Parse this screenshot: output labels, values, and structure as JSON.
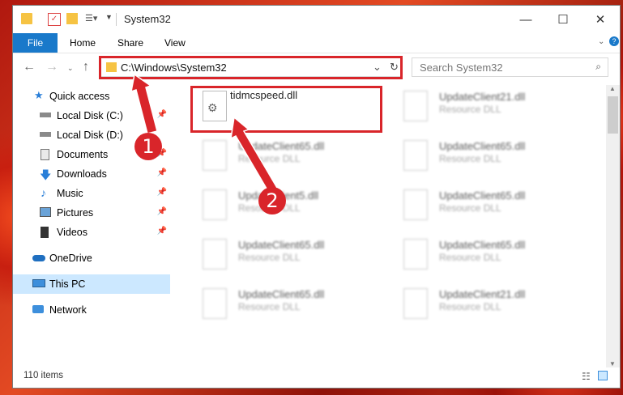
{
  "window": {
    "title": "System32"
  },
  "ribbon": {
    "tabs": [
      "File",
      "Home",
      "Share",
      "View"
    ]
  },
  "address": {
    "path": "C:\\Windows\\System32"
  },
  "search": {
    "placeholder": "Search System32"
  },
  "sidebar": {
    "items": [
      {
        "label": "Quick access",
        "icon": "star-icon"
      },
      {
        "label": "Local Disk (C:)",
        "icon": "drive-icon"
      },
      {
        "label": "Local Disk (D:)",
        "icon": "drive-icon"
      },
      {
        "label": "Documents",
        "icon": "documents-icon"
      },
      {
        "label": "Downloads",
        "icon": "download-icon"
      },
      {
        "label": "Music",
        "icon": "music-icon"
      },
      {
        "label": "Pictures",
        "icon": "pictures-icon"
      },
      {
        "label": "Videos",
        "icon": "videos-icon"
      },
      {
        "label": "OneDrive",
        "icon": "cloud-icon"
      },
      {
        "label": "This PC",
        "icon": "computer-icon"
      },
      {
        "label": "Network",
        "icon": "network-icon"
      }
    ]
  },
  "files": [
    {
      "name": "tidmcspeed.dll",
      "type": ""
    },
    {
      "name": "UpdateClient21.dll",
      "type": "Resource DLL"
    },
    {
      "name": "UpdateClient65.dll",
      "type": "Resource DLL"
    },
    {
      "name": "UpdateClient65.dll",
      "type": "Resource DLL"
    },
    {
      "name": "UpdateClient5.dll",
      "type": "Resource DLL"
    },
    {
      "name": "UpdateClient65.dll",
      "type": "Resource DLL"
    },
    {
      "name": "UpdateClient65.dll",
      "type": "Resource DLL"
    },
    {
      "name": "UpdateClient65.dll",
      "type": "Resource DLL"
    },
    {
      "name": "UpdateClient65.dll",
      "type": "Resource DLL"
    },
    {
      "name": "UpdateClient21.dll",
      "type": "Resource DLL"
    }
  ],
  "status": {
    "item_count": "110 items"
  },
  "annotations": {
    "step1": "1",
    "step2": "2"
  },
  "colors": {
    "highlight_red": "#d9252a",
    "file_tab_blue": "#1979ca",
    "selected_nav": "#cce8ff"
  }
}
